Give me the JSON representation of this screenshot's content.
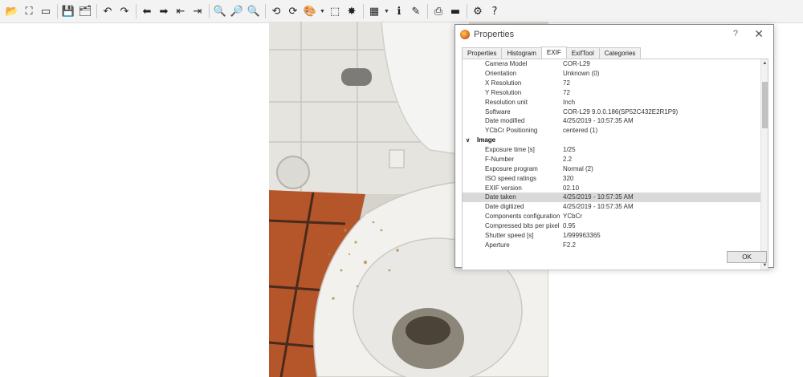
{
  "toolbar": {
    "buttons": [
      {
        "name": "open-folder-icon",
        "glyph": "📂"
      },
      {
        "name": "fullscreen-icon",
        "glyph": "⛶"
      },
      {
        "name": "slideshow-icon",
        "glyph": "▭"
      },
      {
        "name": "save-icon",
        "glyph": "💾"
      },
      {
        "name": "batch-icon",
        "glyph": "🗂"
      },
      {
        "name": "undo-icon",
        "glyph": "↶"
      },
      {
        "name": "redo-icon",
        "glyph": "↷"
      },
      {
        "name": "prev-icon",
        "glyph": "⬅"
      },
      {
        "name": "next-icon",
        "glyph": "➡"
      },
      {
        "name": "first-page-icon",
        "glyph": "⇤"
      },
      {
        "name": "last-page-icon",
        "glyph": "⇥"
      },
      {
        "name": "zoom-in-icon",
        "glyph": "🔍"
      },
      {
        "name": "zoom-fit-icon",
        "glyph": "🔎"
      },
      {
        "name": "zoom-out-icon",
        "glyph": "🔍"
      },
      {
        "name": "rotate-left-icon",
        "glyph": "⟲"
      },
      {
        "name": "rotate-right-icon",
        "glyph": "⟳"
      },
      {
        "name": "paint-icon",
        "glyph": "🎨"
      },
      {
        "name": "crop-icon",
        "glyph": "⬚"
      },
      {
        "name": "effects-icon",
        "glyph": "✸"
      },
      {
        "name": "color-icon",
        "glyph": "▦"
      },
      {
        "name": "info-icon",
        "glyph": "ℹ"
      },
      {
        "name": "edit-icon",
        "glyph": "✎"
      },
      {
        "name": "print-icon",
        "glyph": "⎙"
      },
      {
        "name": "scan-icon",
        "glyph": "▬"
      },
      {
        "name": "settings-icon",
        "glyph": "⚙"
      },
      {
        "name": "help-icon",
        "glyph": "?"
      }
    ]
  },
  "dialog": {
    "title": "Properties",
    "help": "?",
    "close": "✕",
    "tabs": [
      "Properties",
      "Histogram",
      "EXIF",
      "ExifTool",
      "Categories"
    ],
    "active_tab": "EXIF",
    "rows_top": [
      {
        "key": "Camera Model",
        "value": "COR-L29"
      },
      {
        "key": "Orientation",
        "value": "Unknown (0)"
      },
      {
        "key": "X Resolution",
        "value": "72"
      },
      {
        "key": "Y Resolution",
        "value": "72"
      },
      {
        "key": "Resolution unit",
        "value": "Inch"
      },
      {
        "key": "Software",
        "value": "COR-L29 9.0.0.186(SP52C432E2R1P9)"
      },
      {
        "key": "Date modified",
        "value": "4/25/2019 - 10:57:35 AM"
      },
      {
        "key": "YCbCr Positioning",
        "value": "centered (1)"
      }
    ],
    "section": {
      "chevron": "∨",
      "label": "Image"
    },
    "rows_image": [
      {
        "key": "Exposure time [s]",
        "value": "1/25"
      },
      {
        "key": "F-Number",
        "value": "2.2"
      },
      {
        "key": "Exposure program",
        "value": "Normal (2)"
      },
      {
        "key": "ISO speed ratings",
        "value": "320"
      },
      {
        "key": "EXIF version",
        "value": "02.10"
      },
      {
        "key": "Date taken",
        "value": "4/25/2019 - 10:57:35 AM"
      },
      {
        "key": "Date digitized",
        "value": "4/25/2019 - 10:57:35 AM"
      },
      {
        "key": "Components configuration",
        "value": "YCbCr"
      },
      {
        "key": "Compressed bits per pixel",
        "value": "0.95"
      },
      {
        "key": "Shutter speed [s]",
        "value": "1/999963365"
      },
      {
        "key": "Aperture",
        "value": "F2.2"
      }
    ],
    "selected_key": "Date taken",
    "ok_label": "OK"
  },
  "colors": {
    "selected_row": "#d9d9d9",
    "wall_tile": "#e6e4df",
    "floor_tile": "#b5552a"
  }
}
